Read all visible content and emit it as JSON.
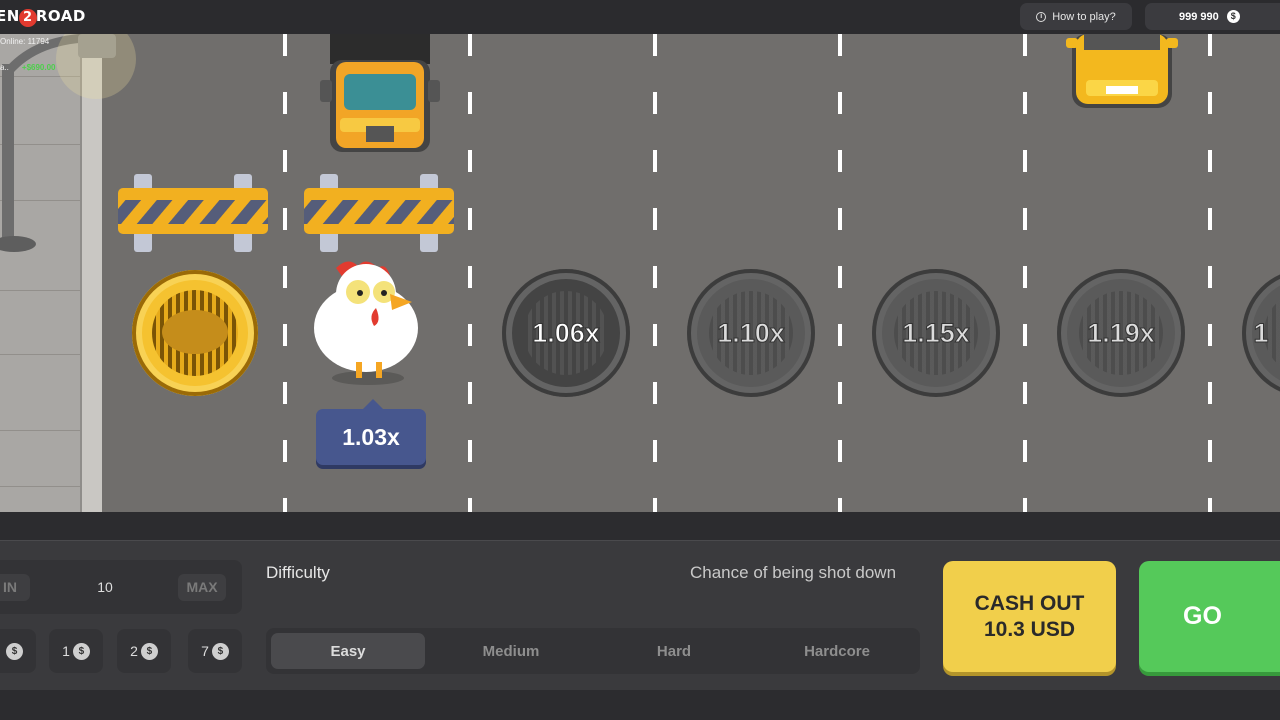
{
  "header": {
    "logo_prefix": "EN",
    "logo_two": "2",
    "logo_suffix": "ROAD",
    "how_to_play": "How to play?",
    "balance": "999 990",
    "currency_icon": "dollar-coin-icon"
  },
  "live": {
    "online": "Online: 11794",
    "last_win_user": "a..",
    "last_win_amount": "+$690.00"
  },
  "road": {
    "multipliers": [
      "1.06x",
      "1.10x",
      "1.15x",
      "1.19x",
      "1"
    ],
    "current_multiplier": "1.03x"
  },
  "controls": {
    "bet": {
      "min_label": "IN",
      "value": "10",
      "max_label": "MAX"
    },
    "quick_bets": [
      {
        "label": ""
      },
      {
        "label": "1"
      },
      {
        "label": "2"
      },
      {
        "label": "7"
      }
    ],
    "difficulty_label": "Difficulty",
    "chance_label": "Chance of being shot down",
    "difficulties": [
      "Easy",
      "Medium",
      "Hard",
      "Hardcore"
    ],
    "active_difficulty": "Easy",
    "cashout_line1": "CASH OUT",
    "cashout_line2": "10.3 USD",
    "go": "GO"
  },
  "colors": {
    "road": "#706e6c",
    "cashout": "#f1cf4b",
    "go": "#55c95a",
    "marker": "#47578e",
    "win": "#4cd04a"
  }
}
